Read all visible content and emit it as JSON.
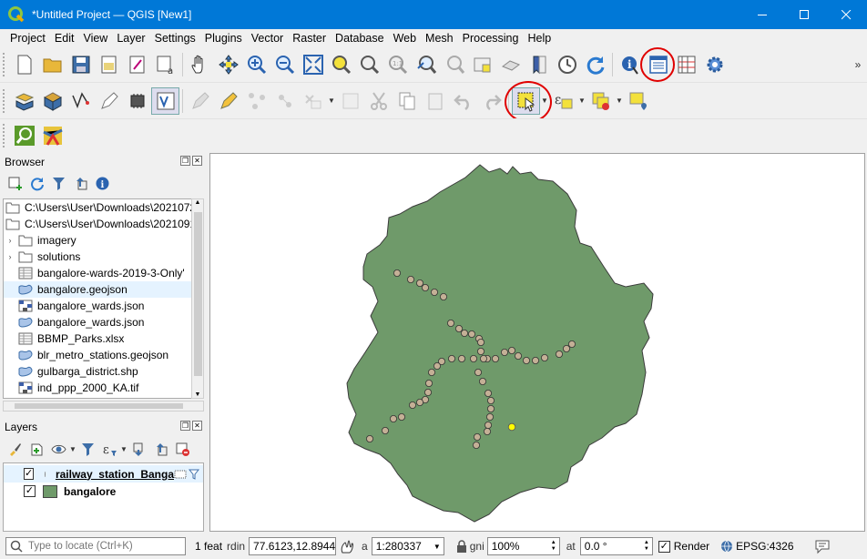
{
  "window": {
    "title": "*Untitled Project — QGIS [New1]"
  },
  "menu": [
    "Project",
    "Edit",
    "View",
    "Layer",
    "Settings",
    "Plugins",
    "Vector",
    "Raster",
    "Database",
    "Web",
    "Mesh",
    "Processing",
    "Help"
  ],
  "browser": {
    "title": "Browser",
    "items": [
      {
        "label": "C:\\Users\\User\\Downloads\\2021072",
        "icon": "folder-icon",
        "expand": ""
      },
      {
        "label": "C:\\Users\\User\\Downloads\\2021091",
        "icon": "folder-icon",
        "expand": ""
      },
      {
        "label": "imagery",
        "icon": "folder-icon",
        "expand": "›"
      },
      {
        "label": "solutions",
        "icon": "folder-icon",
        "expand": "›"
      },
      {
        "label": "bangalore-wards-2019-3-Only'",
        "icon": "table-icon",
        "expand": ""
      },
      {
        "label": "bangalore.geojson",
        "icon": "polygon-icon",
        "expand": ""
      },
      {
        "label": "bangalore_wards.json",
        "icon": "raster-icon",
        "expand": ""
      },
      {
        "label": "bangalore_wards.json",
        "icon": "polygon-icon",
        "expand": ""
      },
      {
        "label": "BBMP_Parks.xlsx",
        "icon": "table-icon",
        "expand": ""
      },
      {
        "label": "blr_metro_stations.geojson",
        "icon": "polygon-icon",
        "expand": ""
      },
      {
        "label": "gulbarga_district.shp",
        "icon": "polygon-icon",
        "expand": ""
      },
      {
        "label": "ind_ppp_2000_KA.tif",
        "icon": "raster-icon",
        "expand": ""
      }
    ]
  },
  "layers": {
    "title": "Layers",
    "items": [
      {
        "label": "railway_station_Banga",
        "checked": "✓",
        "icon": "point-layer-icon",
        "color": "#8a8a8a"
      },
      {
        "label": "bangalore",
        "checked": "✓",
        "icon": "polygon-layer-icon",
        "color": "#6f9a6a"
      }
    ]
  },
  "colors": {
    "polygon_fill": "#6f9a6a",
    "polygon_stroke": "#3b3b3b",
    "point_fill": "#c4b096",
    "selected_point": "#ffff00"
  },
  "status": {
    "locate_placeholder": "Type to locate (Ctrl+K)",
    "feature_text": "1 feat",
    "coord_label": "rdin",
    "coordinate": "77.6123,12.8944",
    "scale_label": "a",
    "scale": "1:280337",
    "magnifier_label": "gni",
    "magnifier": "100%",
    "rotation_label": "at",
    "rotation": "0.0 °",
    "render_label": "Render",
    "render_checked": "✓",
    "crs": "EPSG:4326"
  }
}
